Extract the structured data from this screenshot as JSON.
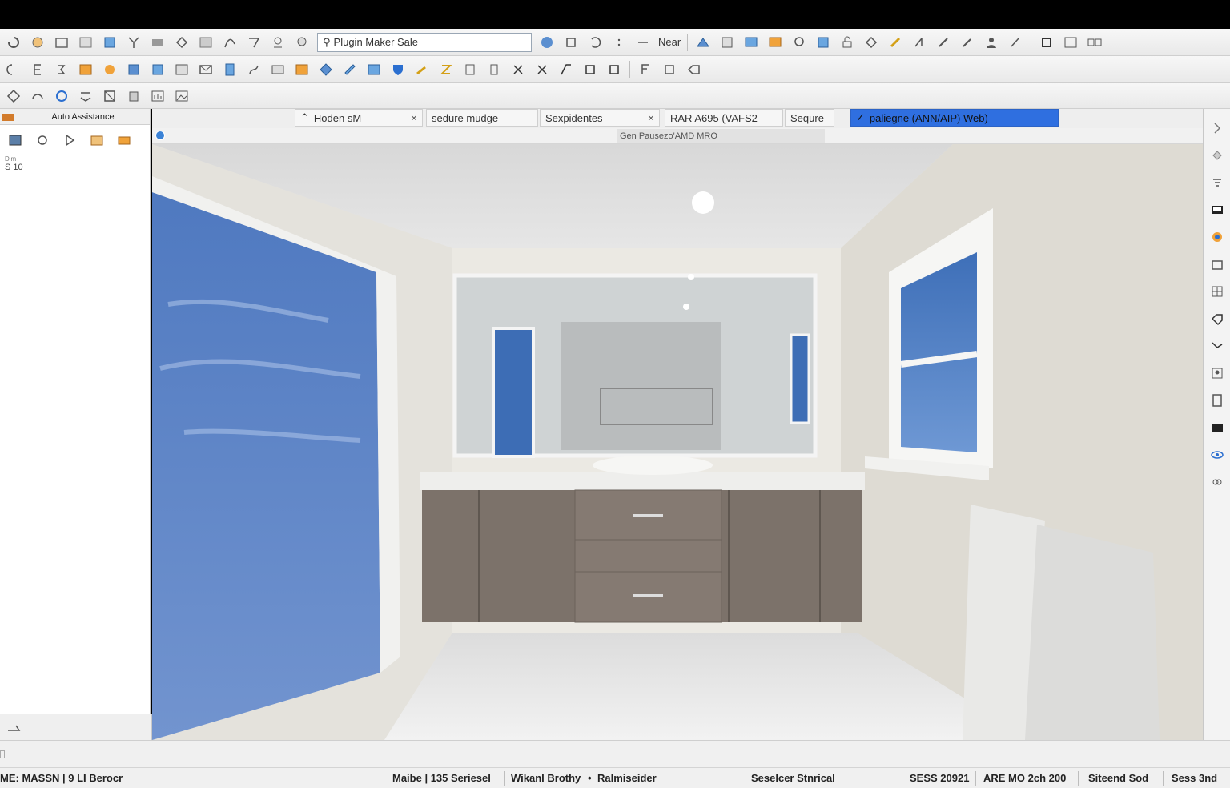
{
  "toolbar1": {
    "search_value": "Plugin Maker Sale",
    "text_near": "Near"
  },
  "left_panel": {
    "title": "Auto Assistance",
    "small": "Dim",
    "value": "S 10"
  },
  "tabs": [
    {
      "label": "Hoden sM",
      "closable": true
    },
    {
      "label": "sedure mudge",
      "closable": false
    },
    {
      "label": "Sexpidentes",
      "closable": true
    },
    {
      "label": "RAR A695 (VAFS2",
      "closable": false
    },
    {
      "label": "Sequre",
      "closable": false
    },
    {
      "label": "paliegne (ANN/AIP) Web)",
      "closable": false,
      "active": true
    }
  ],
  "subbar": {
    "status_text": "Gen Pausezo'AMD MRO"
  },
  "statusbar": {
    "left": "ME: MASSN | 9 LI Berocr",
    "mid1": "Maibe | 135 Seriesel",
    "mid2": "Wikanl Brothy",
    "mid3": "Ralmiseider",
    "mid4": "Seselcer Stnrical",
    "r1": "SESS 20921",
    "r2": "ARE MO 2ch 200",
    "r3": "Siteend Sod",
    "r4": "Sess 3nd"
  },
  "colors": {
    "accent": "#2f6fe0",
    "sky": "#5f86c9",
    "wall": "#e7e5df",
    "cabinet": "#7a7068"
  }
}
